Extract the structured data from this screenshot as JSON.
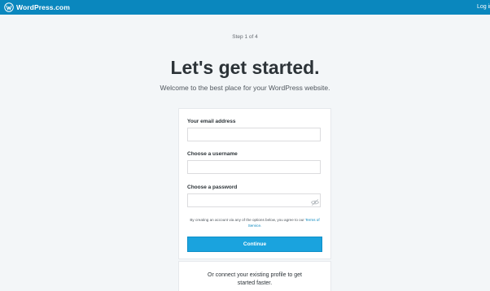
{
  "topbar": {
    "brand_name": "WordPress.com",
    "login_label": "Log in"
  },
  "signup": {
    "step": "Step 1 of 4",
    "headline": "Let's get started.",
    "subheadline": "Welcome to the best place for your WordPress website.",
    "email_label": "Your email address",
    "email_value": "",
    "username_label": "Choose a username",
    "username_value": "",
    "password_label": "Choose a password",
    "password_value": "",
    "terms_text": "By creating an account via any of the options below, you agree to our",
    "terms_link": "Terms of Service.",
    "continue_label": "Continue",
    "connect_line1": "Or connect your existing profile to get",
    "connect_line2": "started faster."
  },
  "colors": {
    "topbar": "#0a87be",
    "page_bg": "#f3f6f8",
    "button": "#1aa3de",
    "link": "#0a87be"
  },
  "icons": {
    "logo": "wordpress-logo-icon",
    "password_toggle": "eye-slash-icon"
  }
}
